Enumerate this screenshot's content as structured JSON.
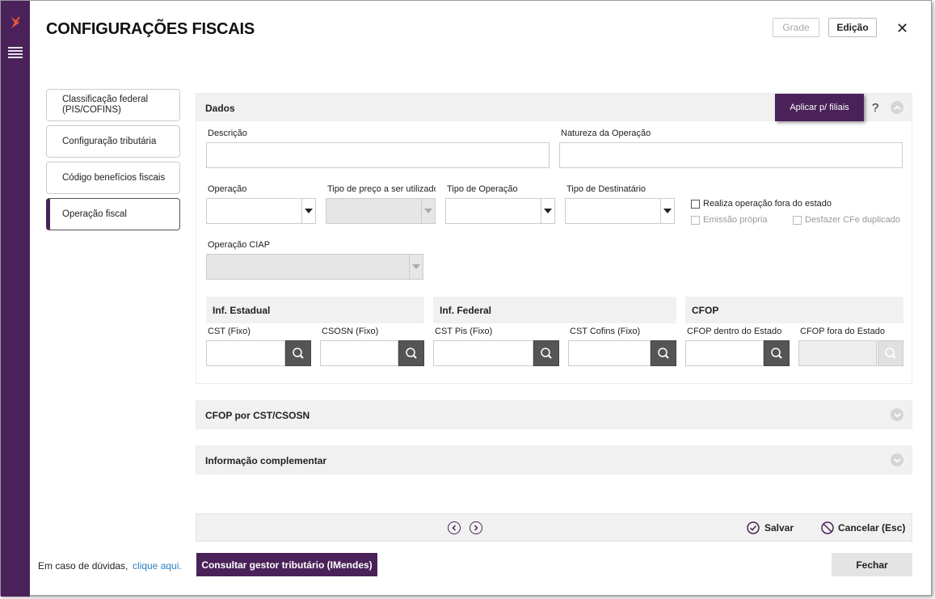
{
  "header": {
    "title": "CONFIGURAÇÕES FISCAIS",
    "grade_label": "Grade",
    "edicao_label": "Edição",
    "close_glyph": "✕"
  },
  "side_tabs": [
    {
      "label": "Classificação federal (PIS/COFINS)"
    },
    {
      "label": "Configuração tributária"
    },
    {
      "label": "Código benefícios fiscais"
    },
    {
      "label": "Operação fiscal"
    }
  ],
  "dados": {
    "title": "Dados",
    "apply_label": "Aplicar p/ filiais",
    "help_glyph": "?",
    "descricao_label": "Descrição",
    "natureza_label": "Natureza da Operação",
    "operacao_label": "Operação",
    "tipo_preco_label": "Tipo de preço a ser utilizado",
    "tipo_operacao_label": "Tipo de Operação",
    "tipo_destinatario_label": "Tipo de Destinatário",
    "realiza_fora_label": "Realiza operação fora do estado",
    "emissao_propria_label": "Emissão própria",
    "desfazer_cfe_label": "Desfazer CFe duplicado",
    "operacao_ciap_label": "Operação CIAP",
    "inf_estadual": {
      "title": "Inf. Estadual",
      "cst_label": "CST (Fixo)",
      "csosn_label": "CSOSN (Fixo)"
    },
    "inf_federal": {
      "title": "Inf. Federal",
      "cst_pis_label": "CST Pis (Fixo)",
      "cst_cofins_label": "CST Cofins (Fixo)"
    },
    "cfop": {
      "title": "CFOP",
      "dentro_label": "CFOP dentro do Estado",
      "fora_label": "CFOP fora do Estado"
    }
  },
  "accordions": {
    "cfop_cst": "CFOP por CST/CSOSN",
    "info_comp": "Informação complementar"
  },
  "footer": {
    "salvar_label": "Salvar",
    "cancelar_label": "Cancelar (Esc)"
  },
  "bottom": {
    "help_text": "Em caso de dúvidas,",
    "help_link": "clique aqui.",
    "imendes_label": "Consultar gestor tributário (IMendes)",
    "fechar_label": "Fechar"
  },
  "colors": {
    "brand": "#4a2259",
    "link": "#2a7fc5"
  }
}
